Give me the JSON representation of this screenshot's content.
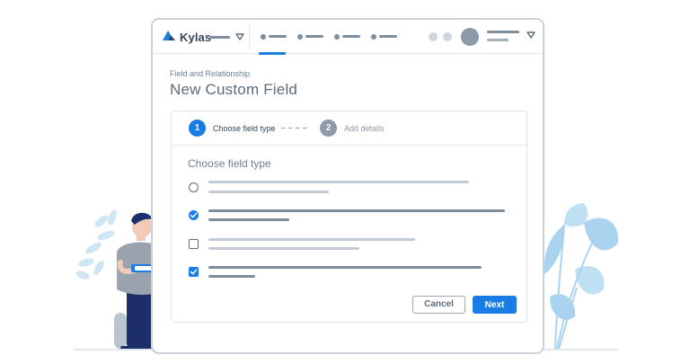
{
  "app": {
    "name": "Kylas"
  },
  "page": {
    "breadcrumb": "Field and Relationship",
    "title": "New Custom Field"
  },
  "stepper": {
    "steps": [
      {
        "number": "1",
        "label": "Choose field type",
        "state": "active"
      },
      {
        "number": "2",
        "label": "Add details",
        "state": "inactive"
      }
    ]
  },
  "section": {
    "title": "Choose field type"
  },
  "options": [
    {
      "control": "radio",
      "checked": false
    },
    {
      "control": "radio",
      "checked": true
    },
    {
      "control": "checkbox",
      "checked": false
    },
    {
      "control": "checkbox",
      "checked": true
    }
  ],
  "buttons": {
    "cancel": "Cancel",
    "next": "Next"
  },
  "icons": {
    "logo": "kylas-logo-icon",
    "menu_chevron": "chevron-down-icon",
    "user_avatar": "avatar",
    "checkmark": "check-icon"
  },
  "colors": {
    "accent": "#1a7de6",
    "text_muted": "#6f8194",
    "placeholder_line": "#7d8d9e",
    "window_border": "#c9d2dc"
  }
}
